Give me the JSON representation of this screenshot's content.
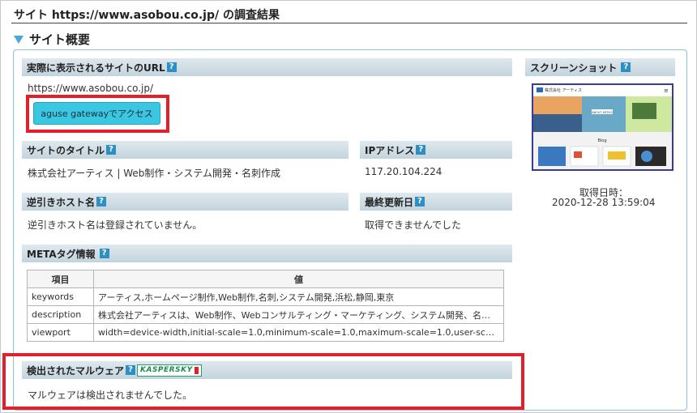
{
  "page": {
    "title": "サイト https://www.asobou.co.jp/ の調査結果",
    "section_title": "サイト概要"
  },
  "url_section": {
    "label": "実際に表示されるサイトのURL",
    "help": "?",
    "value": "https://www.asobou.co.jp/",
    "gateway_button": "aguse gatewayでアクセス"
  },
  "screenshot": {
    "label": "スクリーンショット",
    "help": "?",
    "date_label": "取得日時：",
    "date_value": "2020-12-28 13:59:04",
    "thumb": {
      "brand": "株式会社 アーティス",
      "menu": "≡",
      "hero_caption": "ABOUT ARTISS",
      "blog_heading": "Blog"
    }
  },
  "site_title": {
    "label": "サイトのタイトル",
    "help": "?",
    "value": "株式会社アーティス | Web制作・システム開発・名刺作成"
  },
  "ip": {
    "label": "IPアドレス",
    "help": "?",
    "value": "117.20.104.224"
  },
  "reverse_host": {
    "label": "逆引きホスト名",
    "help": "?",
    "value": "逆引きホスト名は登録されていません。"
  },
  "last_updated": {
    "label": "最終更新日",
    "help": "?",
    "value": "取得できませんでした"
  },
  "meta": {
    "label": "METAタグ情報",
    "help": "?",
    "columns": [
      "項目",
      "値"
    ],
    "rows": [
      {
        "key": "keywords",
        "value": "アーティス,ホームページ制作,Web制作,名刺,システム開発,浜松,静岡,東京"
      },
      {
        "key": "description",
        "value": "株式会社アーティスは、Web制作、Webコンサルティング・マーケティング、システム開発、名刺作成などを行っています。"
      },
      {
        "key": "viewport",
        "value": "width=device-width,initial-scale=1.0,minimum-scale=1.0,maximum-scale=1.0,user-scalable=no"
      }
    ]
  },
  "malware": {
    "label": "検出されたマルウェア",
    "help": "?",
    "brand": "KASPERSKY",
    "value": "マルウェアは検出されませんでした。"
  },
  "colors": {
    "accent": "#3bc6e2",
    "highlight": "#e0202a",
    "help_icon": "#2e8fc2",
    "triangle": "#4aa8d8"
  }
}
